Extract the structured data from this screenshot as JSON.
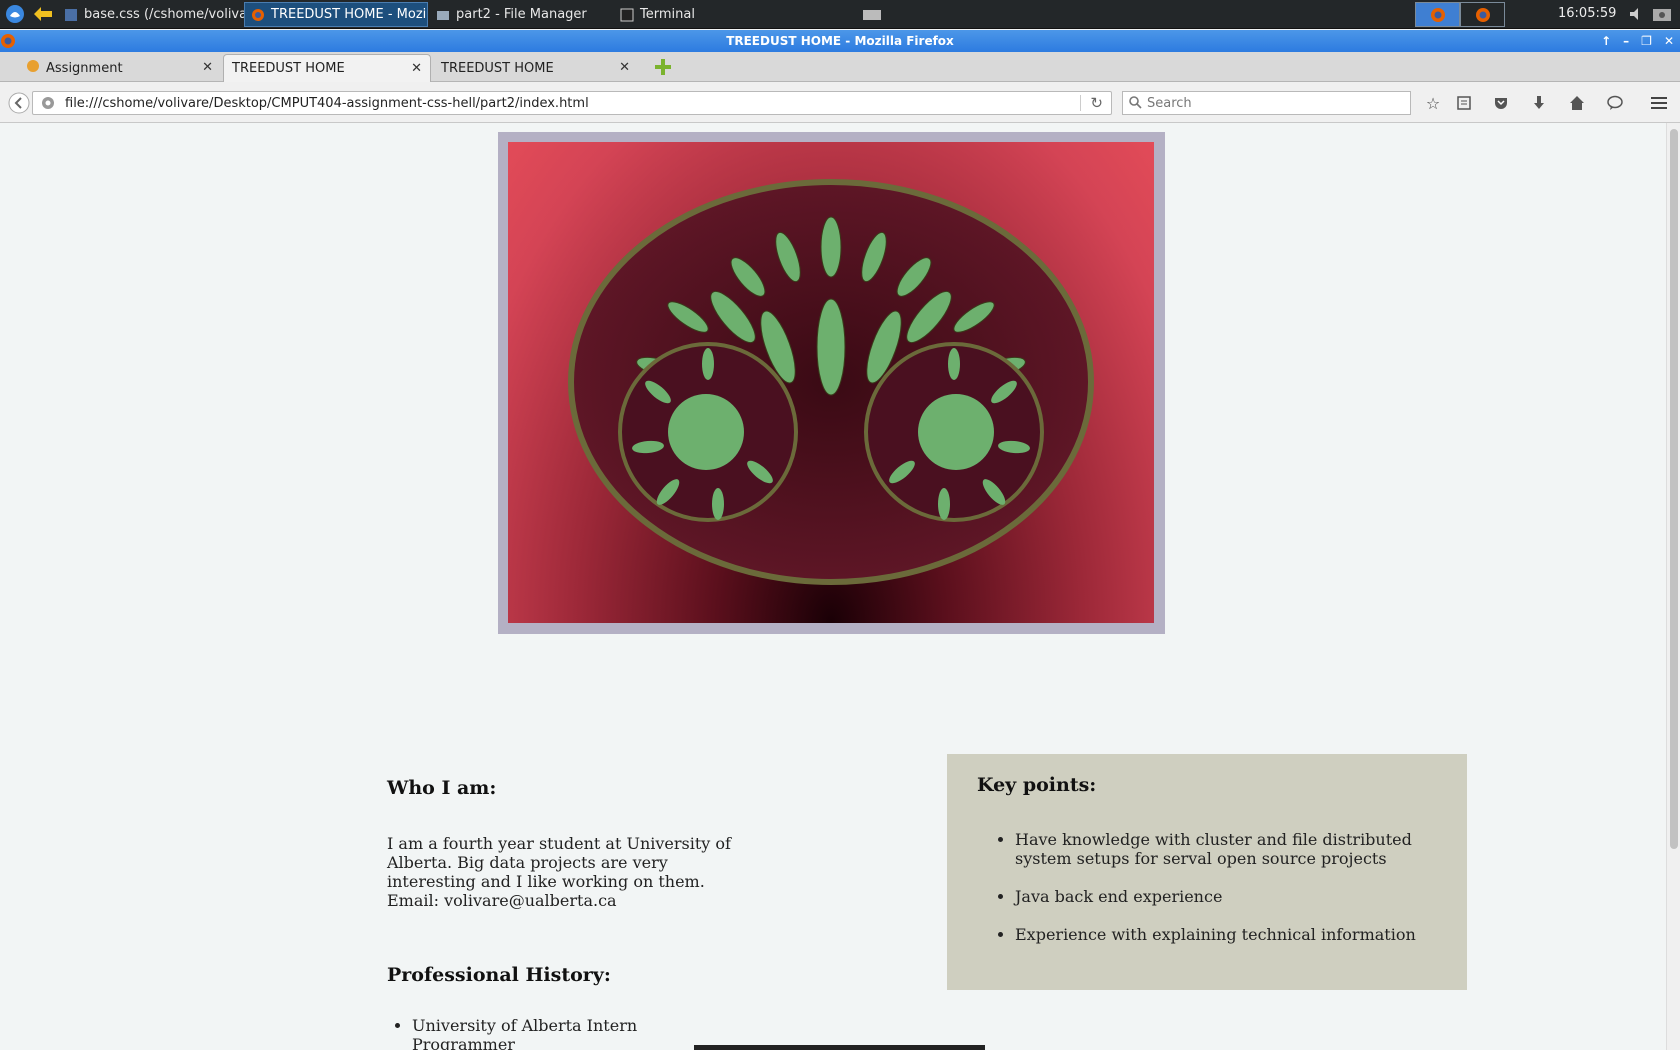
{
  "taskbar": {
    "tasks": [
      {
        "label": "base.css (/cshome/volivar...",
        "active": false
      },
      {
        "label": "TREEDUST HOME - Mozilla...",
        "active": true
      },
      {
        "label": "part2 - File Manager",
        "active": false
      },
      {
        "label": "Terminal",
        "active": false
      }
    ],
    "clock": "16:05:59"
  },
  "window": {
    "title": "TREEDUST HOME - Mozilla Firefox"
  },
  "browser": {
    "tabs": [
      {
        "label": "Assignment"
      },
      {
        "label": "TREEDUST HOME"
      },
      {
        "label": "TREEDUST HOME"
      }
    ],
    "url": "file:///cshome/volivare/Desktop/CMPUT404-assignment-css-hell/part2/index.html",
    "search_placeholder": "Search"
  },
  "page": {
    "who_title": "Who I am:",
    "who_text": "I am a fourth year student at University of Alberta. Big data projects are very interesting and I like working on them.",
    "email": "Email: volivare@ualberta.ca",
    "history_title": "Professional History:",
    "history_items": [
      "University of Alberta Intern Programmer"
    ],
    "key_title": "Key points:",
    "key_points": [
      "Have knowledge with cluster and file distributed system setups for serval open source projects",
      "Java back end experience",
      "Experience with explaining technical information"
    ]
  },
  "colors": {
    "titlebar": "#2d7be0",
    "keybox": "#cfcfc0",
    "page_bg": "#f2f5f5",
    "hero_frame": "#b4b0c4"
  }
}
